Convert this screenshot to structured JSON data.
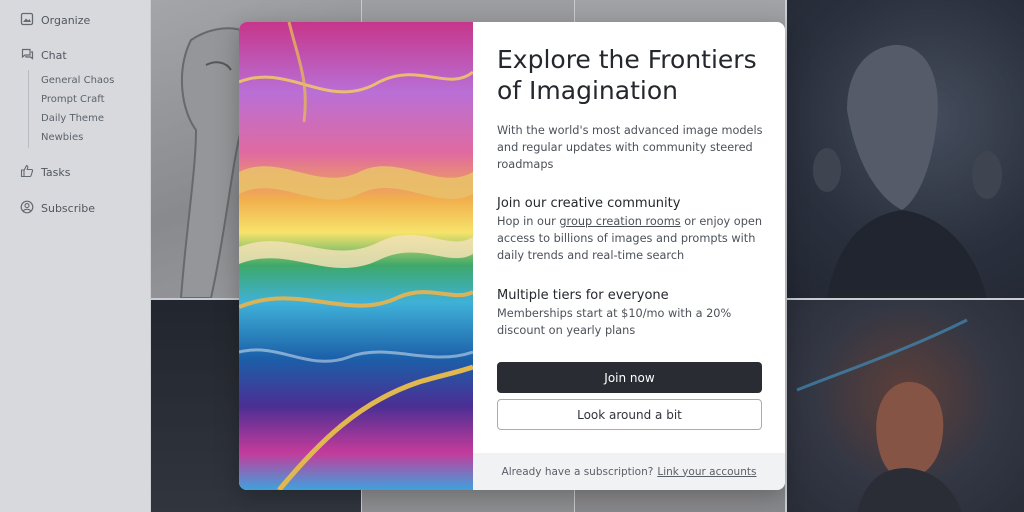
{
  "sidebar": {
    "organize": "Organize",
    "chat": "Chat",
    "chat_channels": [
      "General Chaos",
      "Prompt Craft",
      "Daily Theme",
      "Newbies"
    ],
    "tasks": "Tasks",
    "subscribe": "Subscribe"
  },
  "modal": {
    "title": "Explore the Frontiers of Imagination",
    "intro": "With the world's most advanced image models and regular updates with community steered roadmaps",
    "community_title": "Join our creative community",
    "community_prefix": "Hop in our ",
    "community_link": "group creation rooms",
    "community_suffix": " or enjoy open access to billions of images and prompts with daily trends and real-time search",
    "tiers_title": "Multiple tiers for everyone",
    "tiers_body": "Memberships start at $10/mo with a 20% discount on yearly plans",
    "primary_button": "Join now",
    "secondary_button": "Look around a bit",
    "footer_text": "Already have a subscription?",
    "footer_link": "Link your accounts"
  },
  "icons": {
    "organize": "image-icon",
    "chat": "chat-icon",
    "tasks": "thumbs-up-icon",
    "subscribe": "user-circle-icon"
  },
  "colors": {
    "primary_button": "#292c33",
    "overlay": "#c9ccd1"
  }
}
